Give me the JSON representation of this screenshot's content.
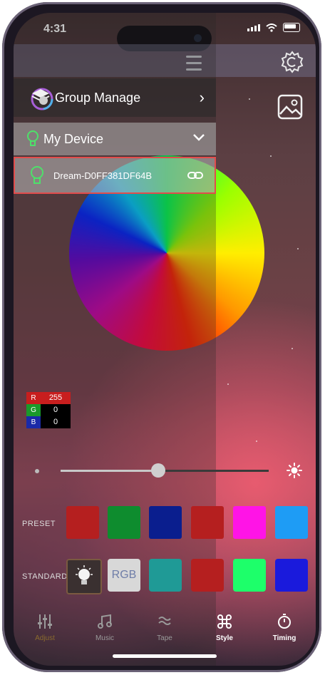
{
  "status_bar": {
    "time": "4:31"
  },
  "drawer": {
    "group_manage": "Group Manage",
    "my_device": "My Device",
    "device_name": "Dream-D0FF381DF64B"
  },
  "rgb": {
    "r_label": "R",
    "r_value": "255",
    "g_label": "G",
    "g_value": "0",
    "b_label": "B",
    "b_value": "0"
  },
  "brightness": {
    "level": 0.47
  },
  "preset": {
    "label": "PRESET",
    "colors": [
      "#b51f1f",
      "#0e8c2e",
      "#0a1e8e",
      "#b51f1f",
      "#ff14e6",
      "#1e9cf5"
    ]
  },
  "standard": {
    "label": "STANDARD",
    "rgb_label": "RGB",
    "colors": [
      "#1f9a96",
      "#b51f1f",
      "#1dff6a",
      "#1a1adc"
    ]
  },
  "tabs": [
    {
      "label": "Adjust",
      "icon": "sliders-icon"
    },
    {
      "label": "Music",
      "icon": "music-icon"
    },
    {
      "label": "Tape",
      "icon": "tape-icon"
    },
    {
      "label": "Style",
      "icon": "command-icon"
    },
    {
      "label": "Timing",
      "icon": "stopwatch-icon"
    }
  ],
  "active_tab": "Style",
  "accent_colors": {
    "highlight_border": "#e24c4c",
    "active_tab_text": "#ffffff",
    "inactive_tab_text": "#9a9a9a"
  }
}
